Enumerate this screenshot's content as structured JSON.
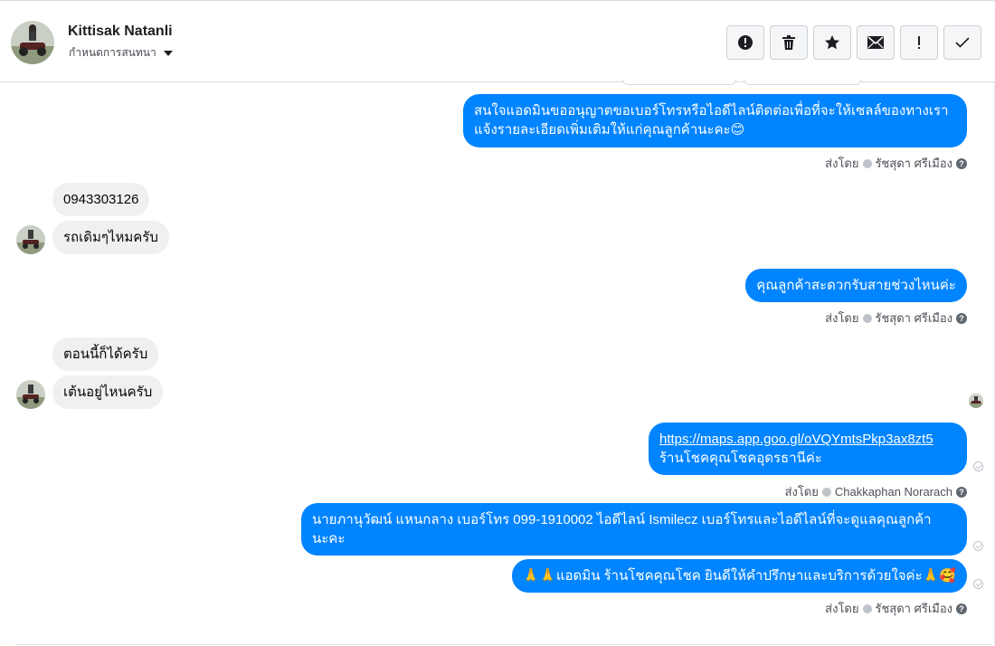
{
  "contact": {
    "name": "Kittisak Natanli",
    "assign_label": "กำหนดการสนทนา"
  },
  "toolbar": {
    "buttons": [
      {
        "icon": "alert-circle-icon",
        "name": "spam-button"
      },
      {
        "icon": "trash-icon",
        "name": "delete-button"
      },
      {
        "icon": "star-icon",
        "name": "star-button"
      },
      {
        "icon": "envelope-icon",
        "name": "mark-unread-button"
      },
      {
        "icon": "exclamation-icon",
        "name": "follow-up-button"
      },
      {
        "icon": "check-icon",
        "name": "mark-done-button"
      }
    ]
  },
  "messages": {
    "m1": {
      "line1": "สนใจแอดมินขออนุญาตขอเบอร์โทรหรือไอดีไลน์ติดต่อเพื่อที่จะให้เซลล์ของทางเรา",
      "line2": "แจ้งรายละเอียดเพิ่มเติมให้แก่คุณลูกค้านะคะ😊"
    },
    "m1_meta": {
      "prefix": "ส่งโดย",
      "sender": "รัชสุดา ศรีเมือง"
    },
    "m2": {
      "text": "0943303126"
    },
    "m3": {
      "text": "รถเดิมๆไหมครับ"
    },
    "m4": {
      "text": "คุณลูกค้าสะดวกรับสายช่วงไหนค่ะ"
    },
    "m4_meta": {
      "prefix": "ส่งโดย",
      "sender": "รัชสุดา ศรีเมือง"
    },
    "m5": {
      "text": "ตอนนี้ก็ได้ครับ"
    },
    "m6": {
      "text": "เต้นอยู่ไหนครับ"
    },
    "m7": {
      "link": "https://maps.app.goo.gl/oVQYmtsPkp3ax8zt5",
      "line2": "ร้านโชคคุณโชคอุดรธานีค่ะ"
    },
    "m7_meta": {
      "prefix": "ส่งโดย",
      "sender": "Chakkaphan Norarach"
    },
    "m8": {
      "line1": "นายภานุวัฒน์ แหนกลาง เบอร์โทร 099-1910002 ไอดีไลน์ Ismilecz   เบอร์โทรและไอดีไลน์ที่จะดูแลคุณลูกค้า",
      "line2": "นะคะ"
    },
    "m9": {
      "text": "🙏🙏แอดมิน ร้านโชคคุณโชค ยินดีให้คำปรึกษาและบริการด้วยใจค่ะ🙏🥰"
    },
    "m9_meta": {
      "prefix": "ส่งโดย",
      "sender": "รัชสุดา ศรีเมือง"
    }
  },
  "colors": {
    "outgoing_bubble": "#0084ff",
    "incoming_bubble": "#f1f0f0"
  }
}
